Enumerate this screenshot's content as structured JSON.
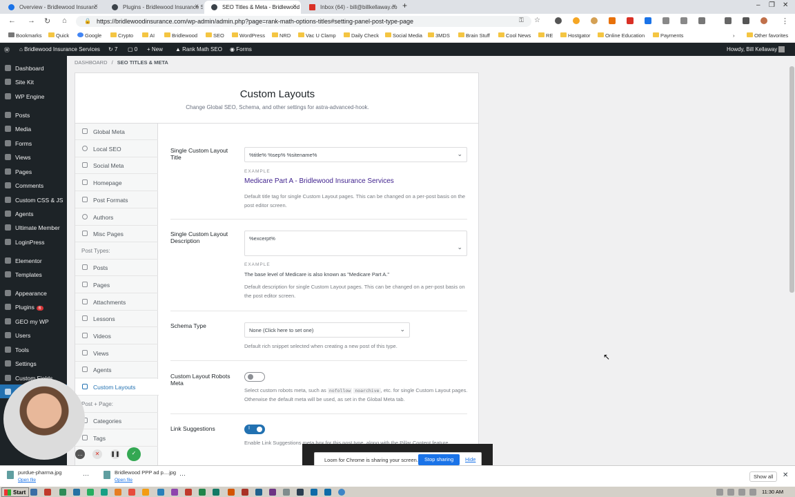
{
  "browser": {
    "tabs": [
      {
        "title": "Overview - Bridlewood Insuranc",
        "active": false,
        "color": "#1a73e8"
      },
      {
        "title": "Plugins - Bridlewood Insurance S",
        "active": false,
        "color": "#3c434a"
      },
      {
        "title": "SEO Titles & Meta - Bridlewood I",
        "active": true,
        "color": "#3c434a"
      },
      {
        "title": "Inbox (64) - bill@billkellaway.co",
        "active": false,
        "color": "#d93025"
      }
    ],
    "url": "https://bridlewoodinsurance.com/wp-admin/admin.php?page=rank-math-options-titles#setting-panel-post-type-page",
    "bookmarks": [
      "Bookmarks",
      "Quick",
      "Google",
      "Crypto",
      "AI",
      "Bridlewood",
      "SEO",
      "WordPress",
      "NRD",
      "Vac U Clamp",
      "Daily Check",
      "Social Media",
      "3MDS",
      "Brain Stuff",
      "Cool News",
      "RE",
      "Hostgator",
      "Online Education",
      "Payments"
    ],
    "other_bookmarks": "Other favorites"
  },
  "adminbar": {
    "site_name": "Bridlewood Insurance Services",
    "updates_count": "7",
    "comments_count": "0",
    "new_label": "New",
    "rank_math": "Rank Math SEO",
    "forms": "Forms",
    "howdy": "Howdy, Bill Kellaway"
  },
  "menu": [
    {
      "label": "Dashboard"
    },
    {
      "label": "Site Kit"
    },
    {
      "label": "WP Engine"
    },
    {
      "label": "Posts"
    },
    {
      "label": "Media"
    },
    {
      "label": "Forms"
    },
    {
      "label": "Views"
    },
    {
      "label": "Pages"
    },
    {
      "label": "Comments"
    },
    {
      "label": "Custom CSS & JS"
    },
    {
      "label": "Agents"
    },
    {
      "label": "Ultimate Member"
    },
    {
      "label": "LoginPress"
    },
    {
      "label": "Elementor"
    },
    {
      "label": "Templates"
    },
    {
      "label": "Appearance"
    },
    {
      "label": "Plugins",
      "badge": "6"
    },
    {
      "label": "GEO my WP"
    },
    {
      "label": "Users"
    },
    {
      "label": "Tools"
    },
    {
      "label": "Settings"
    },
    {
      "label": "Custom Fields"
    }
  ],
  "breadcrumb": {
    "root": "DASHBOARD",
    "sep": "/",
    "current": "SEO TITLES & META"
  },
  "panel": {
    "title": "Custom Layouts",
    "subtitle": "Change Global SEO, Schema, and other settings for astra-advanced-hook."
  },
  "tabs": [
    {
      "label": "Global Meta",
      "type": "item"
    },
    {
      "label": "Local SEO",
      "type": "item"
    },
    {
      "label": "Social Meta",
      "type": "item"
    },
    {
      "label": "Homepage",
      "type": "item"
    },
    {
      "label": "Post Formats",
      "type": "item"
    },
    {
      "label": "Authors",
      "type": "item"
    },
    {
      "label": "Misc Pages",
      "type": "item"
    },
    {
      "label": "Post Types:",
      "type": "section"
    },
    {
      "label": "Posts",
      "type": "item"
    },
    {
      "label": "Pages",
      "type": "item"
    },
    {
      "label": "Attachments",
      "type": "item"
    },
    {
      "label": "Lessons",
      "type": "item"
    },
    {
      "label": "Videos",
      "type": "item"
    },
    {
      "label": "Views",
      "type": "item"
    },
    {
      "label": "Agents",
      "type": "item"
    },
    {
      "label": "Custom Layouts",
      "type": "item",
      "active": true
    },
    {
      "label": "Post + Page:",
      "type": "section"
    },
    {
      "label": "Categories",
      "type": "item"
    },
    {
      "label": "Tags",
      "type": "item"
    }
  ],
  "fields": {
    "title": {
      "label": "Single Custom Layout Title",
      "value": "%title% %sep% %sitename%",
      "example_label": "EXAMPLE",
      "example": "Medicare Part A - Bridlewood Insurance Services",
      "help": "Default title tag for single Custom Layout pages. This can be changed on a per-post basis on the post editor screen."
    },
    "description": {
      "label": "Single Custom Layout Description",
      "value": "%excerpt%",
      "example_label": "EXAMPLE",
      "example": "The base level of Medicare is also known as \"Medicare Part A.\"",
      "help": "Default description for single Custom Layout pages. This can be changed on a per-post basis on the post editor screen."
    },
    "schema": {
      "label": "Schema Type",
      "value": "None (Click here to set one)",
      "help": "Default rich snippet selected when creating a new post of this type."
    },
    "robots": {
      "label": "Custom Layout Robots Meta",
      "enabled": false,
      "help_pre": "Select custom robots meta, such as",
      "code1": "nofollow",
      "code2": "noarchive",
      "help_post": ", etc. for single Custom Layout pages. Otherwise the default meta will be used, as set in the Global Meta tab."
    },
    "links": {
      "label": "Link Suggestions",
      "enabled": true,
      "help": "Enable Link Suggestions meta box for this post type, along with the Pillar Content feature."
    }
  },
  "loom": {
    "message": "Loom for Chrome is sharing your screen.",
    "stop": "Stop sharing",
    "hide": "Hide"
  },
  "downloads": [
    {
      "name": "purdue-pharma.jpg",
      "action": "Open file"
    },
    {
      "name": "Bridlewood PPP ad p....jpg",
      "action": "Open file"
    }
  ],
  "show_all": "Show all",
  "taskbar": {
    "start": "Start",
    "clock": "11:30 AM"
  },
  "colors": {
    "accent": "#2271b1",
    "wp_dark": "#1d2327",
    "toggle_on": "#2271b1",
    "loom_blue": "#1a73e8"
  }
}
